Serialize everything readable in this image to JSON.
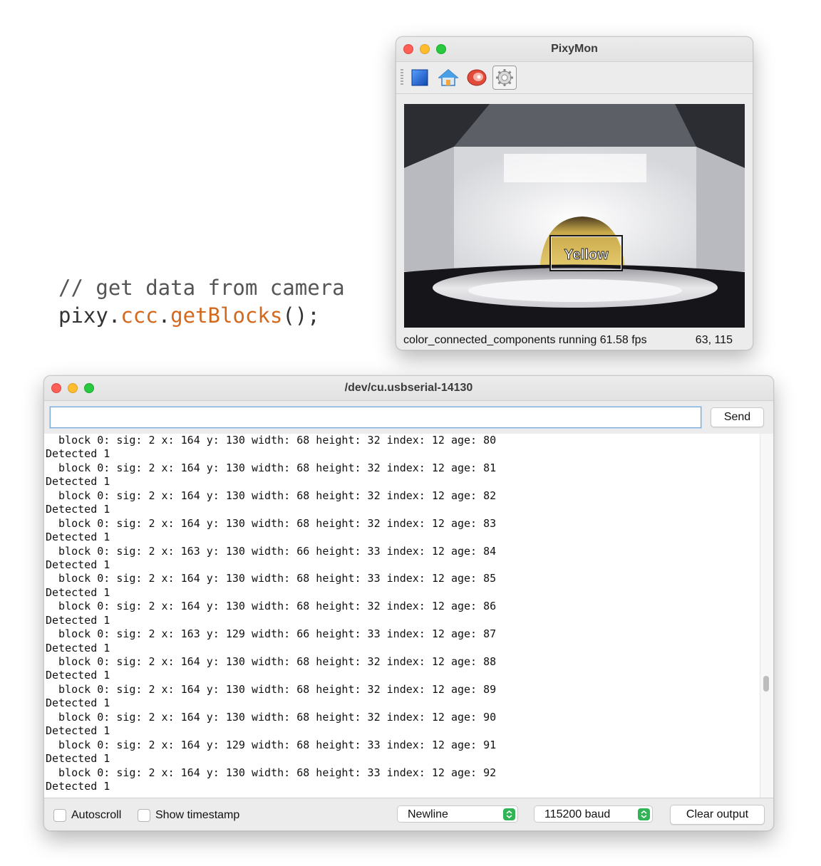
{
  "code": {
    "comment": "// get data from camera",
    "obj": "pixy.",
    "member": "ccc",
    "dot": ".",
    "method": "getBlocks",
    "end": "();"
  },
  "pixymon": {
    "title": "PixyMon",
    "toolbar": [
      {
        "name": "stop-icon"
      },
      {
        "name": "home-icon"
      },
      {
        "name": "raw-video-icon"
      },
      {
        "name": "settings-icon"
      }
    ],
    "block_label": "Yellow",
    "status_text": "color_connected_components running 61.58 fps",
    "coords": "63, 115"
  },
  "serial": {
    "title": "/dev/cu.usbserial-14130",
    "input_value": "",
    "send_label": "Send",
    "output_lines": [
      "  block 0: sig: 2 x: 164 y: 130 width: 68 height: 32 index: 12 age: 80",
      "Detected 1",
      "  block 0: sig: 2 x: 164 y: 130 width: 68 height: 32 index: 12 age: 81",
      "Detected 1",
      "  block 0: sig: 2 x: 164 y: 130 width: 68 height: 32 index: 12 age: 82",
      "Detected 1",
      "  block 0: sig: 2 x: 164 y: 130 width: 68 height: 32 index: 12 age: 83",
      "Detected 1",
      "  block 0: sig: 2 x: 163 y: 130 width: 66 height: 33 index: 12 age: 84",
      "Detected 1",
      "  block 0: sig: 2 x: 164 y: 130 width: 68 height: 33 index: 12 age: 85",
      "Detected 1",
      "  block 0: sig: 2 x: 164 y: 130 width: 68 height: 32 index: 12 age: 86",
      "Detected 1",
      "  block 0: sig: 2 x: 163 y: 129 width: 66 height: 33 index: 12 age: 87",
      "Detected 1",
      "  block 0: sig: 2 x: 164 y: 130 width: 68 height: 32 index: 12 age: 88",
      "Detected 1",
      "  block 0: sig: 2 x: 164 y: 130 width: 68 height: 32 index: 12 age: 89",
      "Detected 1",
      "  block 0: sig: 2 x: 164 y: 130 width: 68 height: 32 index: 12 age: 90",
      "Detected 1",
      "  block 0: sig: 2 x: 164 y: 129 width: 68 height: 33 index: 12 age: 91",
      "Detected 1",
      "  block 0: sig: 2 x: 164 y: 130 width: 68 height: 33 index: 12 age: 92",
      "Detected 1"
    ],
    "autoscroll_label": "Autoscroll",
    "autoscroll_checked": false,
    "timestamp_label": "Show timestamp",
    "timestamp_checked": false,
    "line_ending": "Newline",
    "baud": "115200 baud",
    "clear_label": "Clear output"
  }
}
